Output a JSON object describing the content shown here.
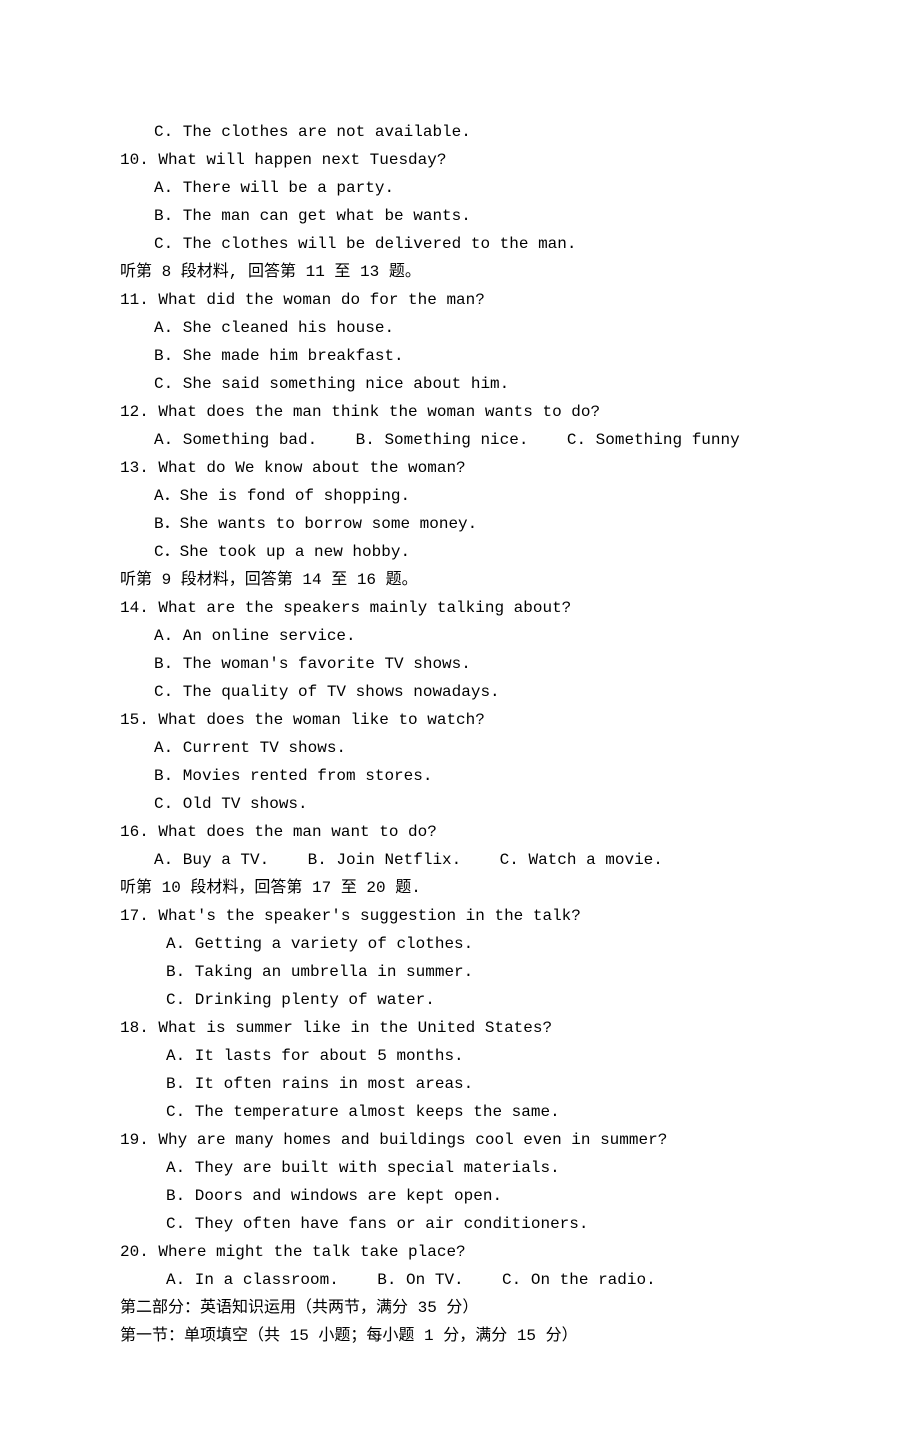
{
  "lines": [
    {
      "indent": 1,
      "text": "C. The clothes are not available."
    },
    {
      "indent": 0,
      "text": "10. What will happen next Tuesday?"
    },
    {
      "indent": 1,
      "text": "A. There will be a party."
    },
    {
      "indent": 1,
      "text": "B. The man can get what be wants."
    },
    {
      "indent": 1,
      "text": "C. The clothes will be delivered to the man."
    },
    {
      "indent": 0,
      "text": "听第 8 段材料, 回答第 11 至 13 题。"
    },
    {
      "indent": 0,
      "text": "11. What did the woman do for the man?"
    },
    {
      "indent": 1,
      "text": "A. She cleaned his house."
    },
    {
      "indent": 1,
      "text": "B. She made him breakfast."
    },
    {
      "indent": 1,
      "text": "C. She said something nice about him."
    },
    {
      "indent": 0,
      "text": "12. What does the man think the woman wants to do?"
    },
    {
      "indent": 1,
      "text": "A. Something bad.    B. Something nice.    C. Something funny"
    },
    {
      "indent": 0,
      "text": "13. What do We know about the woman?"
    },
    {
      "indent": 1,
      "text": "A．She is fond of shopping."
    },
    {
      "indent": 1,
      "text": "B．She wants to borrow some money."
    },
    {
      "indent": 1,
      "text": "C．She took up a new hobby."
    },
    {
      "indent": 0,
      "text": "听第 9 段材料，回答第 14 至 16 题。"
    },
    {
      "indent": 0,
      "text": "14. What are the speakers mainly talking about?"
    },
    {
      "indent": 1,
      "text": "A. An online service."
    },
    {
      "indent": 1,
      "text": "B. The woman's favorite TV shows."
    },
    {
      "indent": 1,
      "text": "C. The quality of TV shows nowadays."
    },
    {
      "indent": 0,
      "text": "15. What does the woman like to watch?"
    },
    {
      "indent": 1,
      "text": "A. Current TV shows."
    },
    {
      "indent": 1,
      "text": "B. Movies rented from stores."
    },
    {
      "indent": 1,
      "text": "C. Old TV shows."
    },
    {
      "indent": 0,
      "text": "16. What does the man want to do?"
    },
    {
      "indent": 1,
      "text": "A. Buy a TV.    B. Join Netflix.    C. Watch a movie."
    },
    {
      "indent": 0,
      "text": "听第 10 段材料，回答第 17 至 20 题."
    },
    {
      "indent": 0,
      "text": "17. What's the speaker's suggestion in the talk?"
    },
    {
      "indent": 2,
      "text": "A. Getting a variety of clothes."
    },
    {
      "indent": 2,
      "text": "B. Taking an umbrella in summer."
    },
    {
      "indent": 2,
      "text": "C. Drinking plenty of water."
    },
    {
      "indent": 0,
      "text": "18. What is summer like in the United States?"
    },
    {
      "indent": 2,
      "text": "A. It lasts for about 5 months."
    },
    {
      "indent": 2,
      "text": "B. It often rains in most areas."
    },
    {
      "indent": 2,
      "text": "C. The temperature almost keeps the same."
    },
    {
      "indent": 0,
      "text": "19. Why are many homes and buildings cool even in summer?"
    },
    {
      "indent": 2,
      "text": "A. They are built with special materials."
    },
    {
      "indent": 2,
      "text": "B. Doors and windows are kept open."
    },
    {
      "indent": 2,
      "text": "C. They often have fans or air conditioners."
    },
    {
      "indent": 0,
      "text": "20. Where might the talk take place?"
    },
    {
      "indent": 2,
      "text": "A. In a classroom.    B. On TV.    C. On the radio."
    },
    {
      "indent": 0,
      "text": "第二部分：英语知识运用（共两节，满分 35 分）"
    },
    {
      "indent": 0,
      "text": "第一节：单项填空（共 15 小题；每小题 1 分，满分 15 分）"
    }
  ]
}
